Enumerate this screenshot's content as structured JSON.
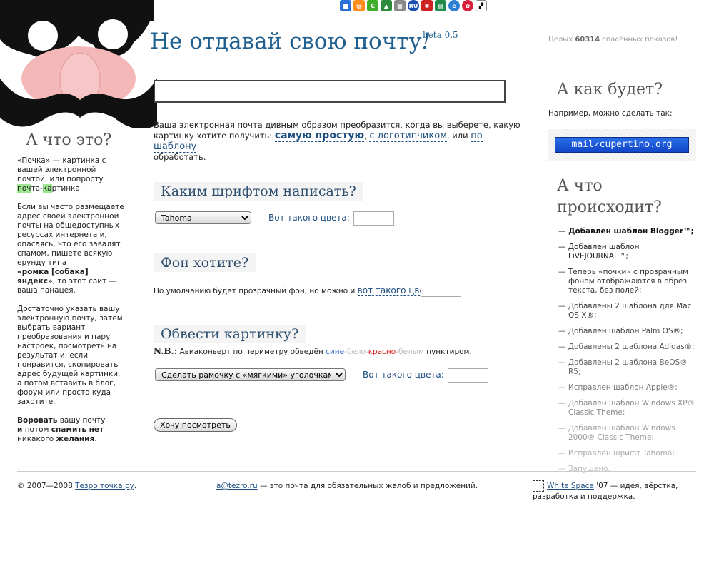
{
  "header": {
    "title": "Не отдавай свою почту",
    "title_excl": "!",
    "beta": "beta 0.5",
    "counter_prefix": "Целых ",
    "counter_value": "60314",
    "counter_suffix": " спасённых показов!"
  },
  "social_icons": [
    "delicious-icon",
    "mail-icon",
    "digg-icon",
    "tree-icon",
    "bookmark-icon",
    "ru-icon",
    "star-icon",
    "book-icon",
    "e-icon",
    "flower-icon",
    "google-icon"
  ],
  "left": {
    "heading": "А что это?",
    "p1_a": "«Почка»  — картинка с вашей электронной почтой, или попросту ",
    "p1_h1": "поч",
    "p1_b": "та-",
    "p1_h2": "ка",
    "p1_c": "ртинка.",
    "p2": "Если вы часто размещаете адрес своей электронной почты на общедоступных ресурсах интернета и, опасаясь, что его завалят спамом, пишете всякую ерунду типа",
    "p2_bold": "«ромка [собака] яндекс»",
    "p2_end": ", то этот сайт — ваша панацея.",
    "p3": "Достаточно указать вашу электронную почту, затем выбрать вариант преобразования и пару настроек, посмотреть на результат и, если понравится, скопировать адрес будущей картинки, а потом вставить в блог, форум или просто куда захотите.",
    "p4_b1": "Воровать",
    "p4_t1": " вашу почту ",
    "p4_b2": "и",
    "p4_t2": " потом ",
    "p4_b3": "спамить нет",
    "p4_t3": " никакого ",
    "p4_b4": "желания",
    "p4_t4": "."
  },
  "main": {
    "email_value": "",
    "intro_a": "Ваша электронная почта дивным образом преобразится, когда вы выберете, какую картинку хотите получить: ",
    "link_simple": "самую простую",
    "intro_b": ", ",
    "link_logo": "с логотипчиком",
    "intro_c": ", или ",
    "link_template": "по шаблону",
    "intro_d": " обработать.",
    "font_heading": "Каким шрифтом написать?",
    "font_selected": "Tahoma",
    "color_label": "Вот такого цвета:",
    "bg_heading": "Фон хотите?",
    "bg_text": "По умолчанию будет прозрачный фон, но можно и ",
    "bg_link": "вот такого цвета:",
    "border_heading": "Обвести картинку?",
    "nb_bold": "N.B.:",
    "nb_text": " Авиаконверт по периметру обведён ",
    "nb_blue": "сине",
    "nb_white1": "-бело-",
    "nb_red": "красно",
    "nb_white2": "-белым",
    "nb_end": " пунктиром.",
    "border_selected": "Сделать рамочку с «мягкими» уголочками.",
    "preview_button": "Хочу посмотреть"
  },
  "right": {
    "heading1": "А как будет?",
    "example_label": "Например, можно сделать так:",
    "example_badge": "mail✓cupertino.org",
    "heading2": "А что происходит?",
    "news": [
      "— Добавлен шаблон Blogger™;",
      "— Добавлен шаблон LiVEJOURNAL™;",
      "— Теперь «почки» с прозрачным фоном отображаются в обрез текста, без полей;",
      "— Добавлены 2 шаблона для Mac OS X®;",
      "— Добавлен шаблон Palm OS®;",
      "— Добавлены 2 шаблона Adidas®;",
      "— Добавлены 2 шаблона BeOS® R5;",
      "— Исправлен шаблон Apple®;",
      "— Добавлен шаблон Windows XP® Classic Theme;",
      "— Добавлен шаблон Windows 2000® Classic Theme;",
      "— Исправлен шрифт Tahoma;",
      "— Запущено."
    ],
    "news_colors": [
      "#111111",
      "#222222",
      "#333333",
      "#3a3a3a",
      "#444444",
      "#555555",
      "#666666",
      "#777777",
      "#888888",
      "#999999",
      "#aaaaaa",
      "#bbbbbb"
    ]
  },
  "footer": {
    "copyright": "© 2007—2008 ",
    "copyright_link": "Тезро точка ру",
    "copyright_end": ".",
    "email_link": "a@tezro.ru",
    "email_text": " — это почта для обязательных жалоб и предложений.",
    "ws_link": "White Space",
    "ws_text": " '07 — идея, вёрстка, разработка и поддержка."
  }
}
